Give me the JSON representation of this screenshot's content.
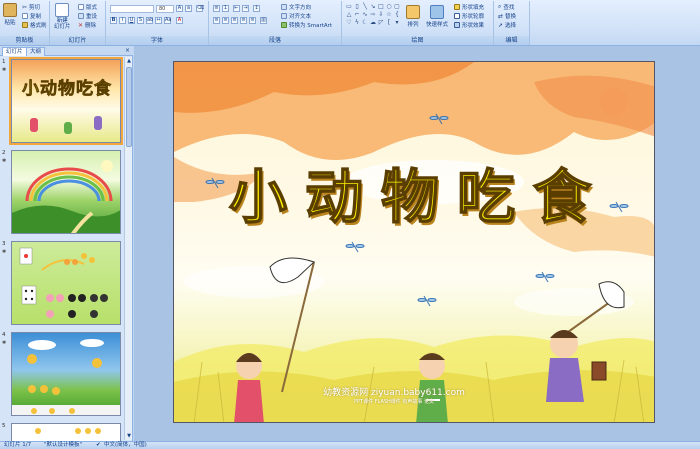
{
  "ribbon": {
    "clipboard": {
      "label": "剪贴板",
      "paste": "粘贴",
      "cut": "剪切",
      "copy": "复制",
      "format_painter": "格式刷"
    },
    "slides": {
      "label": "幻灯片",
      "new_slide": "新建\n幻灯片",
      "layout": "版式",
      "reset": "重设",
      "delete": "删除"
    },
    "font": {
      "label": "字体",
      "size_value": "80"
    },
    "paragraph": {
      "label": "段落",
      "text_direction": "文字方向",
      "align_text": "对齐文本",
      "convert_smartart": "转换为 SmartArt"
    },
    "drawing": {
      "label": "绘图",
      "arrange": "排列",
      "quick_styles": "快速样式",
      "shape_fill": "形状填充",
      "shape_outline": "形状轮廓",
      "shape_effects": "形状效果"
    },
    "editing": {
      "label": "编辑",
      "find": "查找",
      "replace": "替换",
      "select": "选择"
    }
  },
  "left_pane": {
    "tab_slides": "幻灯片",
    "tab_outline": "大纲",
    "close_label": "×",
    "slides": [
      {
        "number": "1",
        "anim": "✱",
        "selected": true
      },
      {
        "number": "2",
        "anim": "✱",
        "selected": false
      },
      {
        "number": "3",
        "anim": "✱",
        "selected": false
      },
      {
        "number": "4",
        "anim": "✱",
        "selected": false
      },
      {
        "number": "5",
        "anim": "",
        "selected": false
      }
    ],
    "thumb1_title": "小动物吃食"
  },
  "slide": {
    "title": "小动物吃食",
    "watermark_main": "幼教资源网 ziyuan.baby611.com",
    "watermark_sub": "PPT课件  FLASH课件  有声故事  论文"
  },
  "status_bar": {
    "slide_info": "幻灯片 1/7",
    "theme": "\"默认设计模板\"",
    "language": "中文(简体，中国)"
  },
  "colors": {
    "ribbon_bg": "#d3e3f8",
    "title_fill": "#fff200",
    "title_outline": "#5a3e00",
    "sky_orange": "#f08a3a",
    "selection_border": "#f3a63b"
  }
}
